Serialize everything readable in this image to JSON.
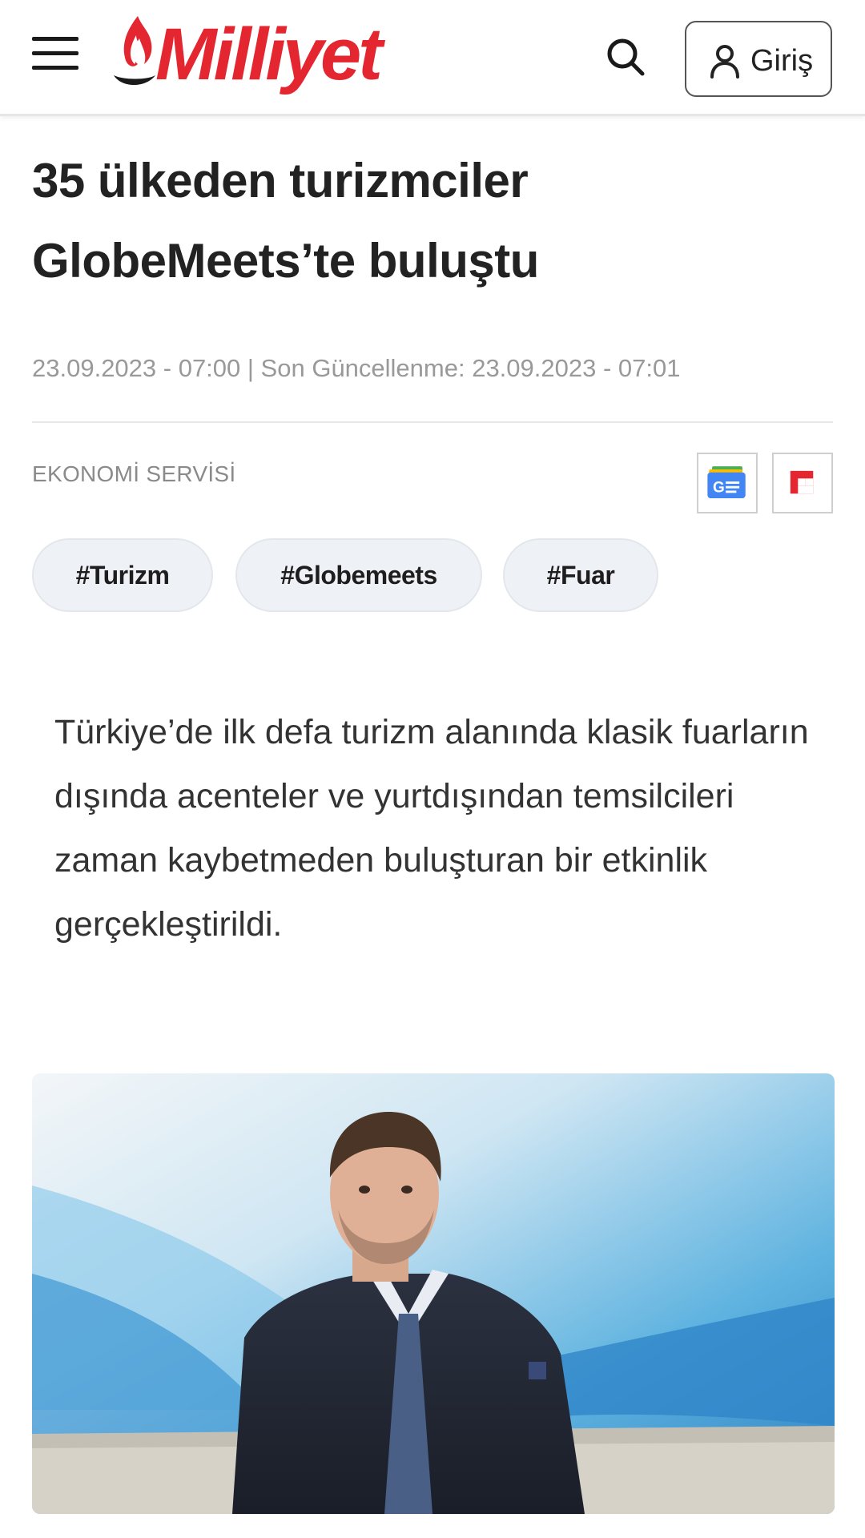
{
  "header": {
    "logo_text": "Milliyet",
    "login_label": "Giriş",
    "menu_icon": "hamburger-icon",
    "search_icon": "search-icon",
    "user_icon": "user-icon"
  },
  "article": {
    "title": "35 ülkeden turizmciler GlobeMeets’te buluştu",
    "dateline": "23.09.2023 - 07:00 | Son Güncellenme: 23.09.2023 - 07:01",
    "service": "EKONOMİ SERVİSİ",
    "tags": [
      "#Turizm",
      "#Globemeets",
      "#Fuar"
    ],
    "lead": "Türkiye’de ilk defa turizm alanında klasik fuarların dışında acenteler ve yurtdışından temsilcileri zaman kaybetmeden buluşturan bir etkinlik gerçekleştirildi."
  },
  "share": {
    "google_news_icon": "google-news-icon",
    "flipboard_icon": "flipboard-icon"
  },
  "colors": {
    "brand_red": "#e3262f",
    "tag_bg": "#eef1f5",
    "muted_text": "#999999"
  }
}
